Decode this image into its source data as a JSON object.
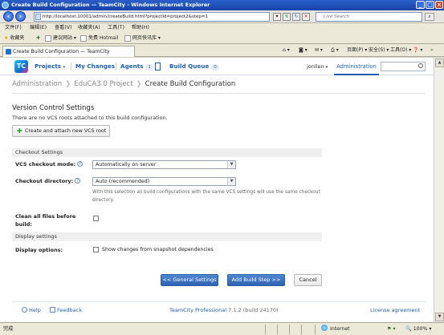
{
  "window": {
    "title": "Create Build Configuration — TeamCity - Windows Internet Explorer"
  },
  "address_bar": {
    "url": "http://localhost:10001/admin/createBuild.html?projectId=project2&step=1",
    "search_placeholder": "Live Search"
  },
  "menu": [
    "文件(F)",
    "编辑(E)",
    "查看(V)",
    "收藏夹(A)",
    "工具(T)",
    "帮助(H)"
  ],
  "favorites": {
    "label": "收藏夹",
    "items": [
      "建议网站 ▾",
      "免费 Hotmail",
      "网页快讯库 ▾"
    ]
  },
  "browser_tab": {
    "title": "Create Build Configuration — TeamCity"
  },
  "command_bar": {
    "page": "页面(P) ▾",
    "safety": "安全(S) ▾",
    "tools": "工具(O) ▾",
    "help": "❓ ▾"
  },
  "tc_header": {
    "logo": "TC",
    "nav": {
      "projects": "Projects",
      "my_changes": "My Changes",
      "agents": "Agents",
      "agents_count": "1",
      "build_queue": "Build Queue",
      "queue_count": "0"
    },
    "user": "jonllen",
    "administration": "Administration"
  },
  "breadcrumb": {
    "items": [
      "Administration",
      "EduCA3.0 Project",
      "Create Build Configuration"
    ]
  },
  "vcs": {
    "title": "Version Control Settings",
    "description": "There are no VCS roots attached to this build configuration.",
    "attach_button": "Create and attach new VCS root"
  },
  "checkout_settings": {
    "header": "Checkout Settings",
    "vcs_mode_label": "VCS checkout mode:",
    "vcs_mode_value": "Automatically on server",
    "dir_label": "Checkout directory:",
    "dir_value": "Auto (recommended)",
    "dir_note": "With this selection all build configurations with the same VCS settings will use the same checkout directory.",
    "clean_label": "Clean all files before build:"
  },
  "display_settings": {
    "header": "Display settings",
    "options_label": "Display options:",
    "snapshot_label": "Show changes from snapshot dependencies"
  },
  "buttons": {
    "general": "<< General Settings",
    "add_step": "Add Build Step >>",
    "cancel": "Cancel"
  },
  "footer": {
    "help": "Help",
    "feedback": "Feedback",
    "product": "TeamCity Professional",
    "version": "7.1.2 (build 24170)",
    "license": "License agreement"
  },
  "status_bar": {
    "status": "完成",
    "zone": "Internet",
    "zoom": "100%"
  }
}
